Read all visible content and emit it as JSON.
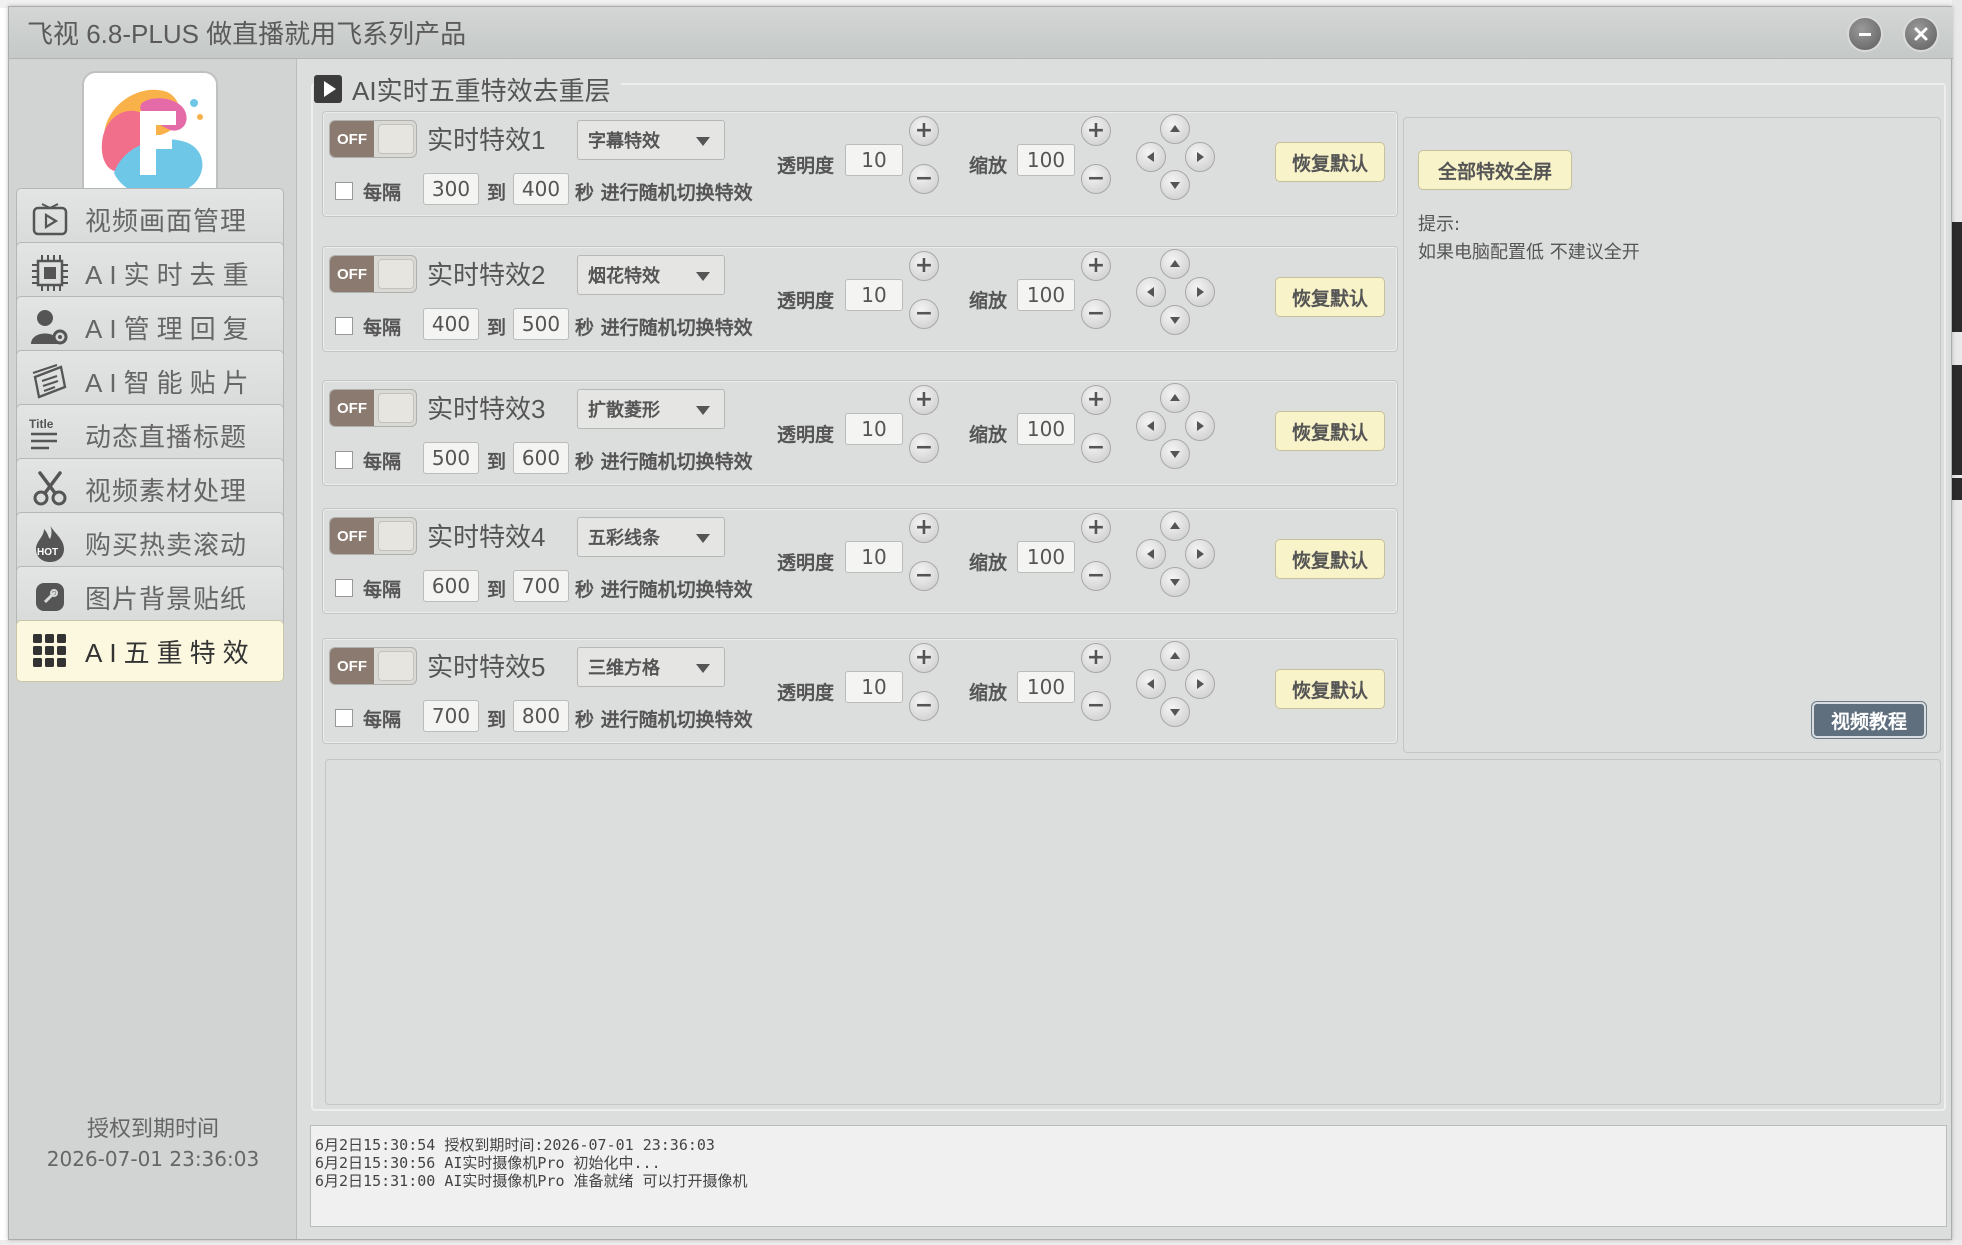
{
  "window": {
    "title": "飞视 6.8-PLUS 做直播就用飞系列产品"
  },
  "sidebar": {
    "logo_letter": "F",
    "items": [
      {
        "label": "视频画面管理",
        "icon": "video-play-icon"
      },
      {
        "label": "AI实时去重",
        "icon": "chip-icon"
      },
      {
        "label": "AI管理回复",
        "icon": "user-gear-icon"
      },
      {
        "label": "AI智能贴片",
        "icon": "layers-icon"
      },
      {
        "label": "动态直播标题",
        "icon": "title-text-icon",
        "icon_text": "Title"
      },
      {
        "label": "视频素材处理",
        "icon": "scissors-icon"
      },
      {
        "label": "购买热卖滚动",
        "icon": "hot-flame-icon",
        "icon_text": "HOT"
      },
      {
        "label": "图片背景贴纸",
        "icon": "sticker-tag-icon"
      },
      {
        "label": "AI五重特效",
        "icon": "grid-dots-icon"
      }
    ],
    "active_index": 8,
    "license_label": "授权到期时间",
    "license_time": "2026-07-01 23:36:03"
  },
  "main": {
    "group_title": "AI实时五重特效去重层",
    "effects": [
      {
        "toggle": "OFF",
        "name": "实时特效1",
        "effect": "字幕特效",
        "every": "每隔",
        "from": "300",
        "to_label": "到",
        "to": "400",
        "suffix": "秒 进行随机切换特效",
        "opacity_label": "透明度",
        "opacity": "10",
        "scale_label": "缩放",
        "scale": "100",
        "reset": "恢复默认"
      },
      {
        "toggle": "OFF",
        "name": "实时特效2",
        "effect": "烟花特效",
        "every": "每隔",
        "from": "400",
        "to_label": "到",
        "to": "500",
        "suffix": "秒 进行随机切换特效",
        "opacity_label": "透明度",
        "opacity": "10",
        "scale_label": "缩放",
        "scale": "100",
        "reset": "恢复默认"
      },
      {
        "toggle": "OFF",
        "name": "实时特效3",
        "effect": "扩散菱形",
        "every": "每隔",
        "from": "500",
        "to_label": "到",
        "to": "600",
        "suffix": "秒 进行随机切换特效",
        "opacity_label": "透明度",
        "opacity": "10",
        "scale_label": "缩放",
        "scale": "100",
        "reset": "恢复默认"
      },
      {
        "toggle": "OFF",
        "name": "实时特效4",
        "effect": "五彩线条",
        "every": "每隔",
        "from": "600",
        "to_label": "到",
        "to": "700",
        "suffix": "秒 进行随机切换特效",
        "opacity_label": "透明度",
        "opacity": "10",
        "scale_label": "缩放",
        "scale": "100",
        "reset": "恢复默认"
      },
      {
        "toggle": "OFF",
        "name": "实时特效5",
        "effect": "三维方格",
        "every": "每隔",
        "from": "700",
        "to_label": "到",
        "to": "800",
        "suffix": "秒 进行随机切换特效",
        "opacity_label": "透明度",
        "opacity": "10",
        "scale_label": "缩放",
        "scale": "100",
        "reset": "恢复默认"
      }
    ],
    "fullscreen_label": "全部特效全屏",
    "tip_title": "提示:",
    "tip_text": "如果电脑配置低 不建议全开",
    "tutorial_label": "视频教程"
  },
  "log": [
    "6月2日15:30:54 授权到期时间:2026-07-01 23:36:03",
    "6月2日15:30:56 AI实时摄像机Pro 初始化中...",
    "6月2日15:31:00 AI实时摄像机Pro 准备就绪 可以打开摄像机"
  ],
  "colors": {
    "accent_button": "#f8f3c9",
    "active_nav": "#fbf8df",
    "toggle_off": "#8b7a70",
    "tutorial_button": "#5f6f7e"
  }
}
